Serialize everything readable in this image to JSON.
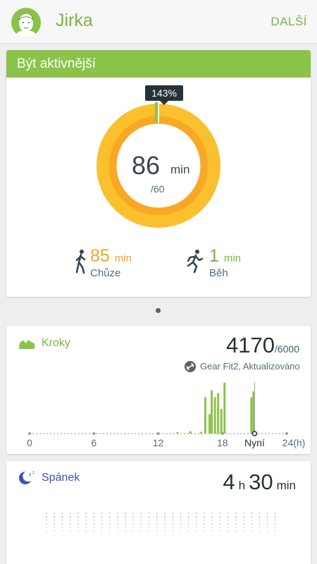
{
  "header": {
    "user_name": "Jirka",
    "more_label": "DALŠÍ"
  },
  "activity_card": {
    "title": "Být aktivnější",
    "percent_label": "143%",
    "total_value": "86",
    "total_unit": "min",
    "goal_label": "/60",
    "progress_ratio": 1.43,
    "walk": {
      "value": "85",
      "unit": "min",
      "label": "Chůze"
    },
    "run": {
      "value": "1",
      "unit": "min",
      "label": "Běh"
    }
  },
  "steps_card": {
    "title": "Kroky",
    "value": "4170",
    "goal": "/6000",
    "sync_text": "Gear Fit2, Aktualizováno",
    "chart_data": {
      "type": "bar",
      "x_ticks": [
        "0",
        "6",
        "12",
        "18",
        "Nyní",
        "24(h)"
      ],
      "x_range_hours": [
        0,
        24
      ],
      "now_hour": 21,
      "hours": [
        13.8,
        15.0,
        16.0,
        16.4,
        16.8,
        17.0,
        17.3,
        17.6,
        17.9,
        18.2,
        20.7,
        20.9
      ],
      "bar_levels": [
        0.02,
        0.04,
        0.03,
        0.62,
        0.33,
        0.74,
        0.62,
        0.69,
        0.42,
        0.87,
        0.62,
        0.72
      ]
    }
  },
  "sleep_card": {
    "title": "Spánek",
    "hours": "4",
    "hours_unit": "h",
    "minutes": "30",
    "minutes_unit": "min"
  },
  "colors": {
    "green": "#8bc34a",
    "ring_outer": "#fbc02d",
    "ring_inner": "#f9a825",
    "walk": "#f5a623",
    "sleep": "#3f51b5"
  }
}
